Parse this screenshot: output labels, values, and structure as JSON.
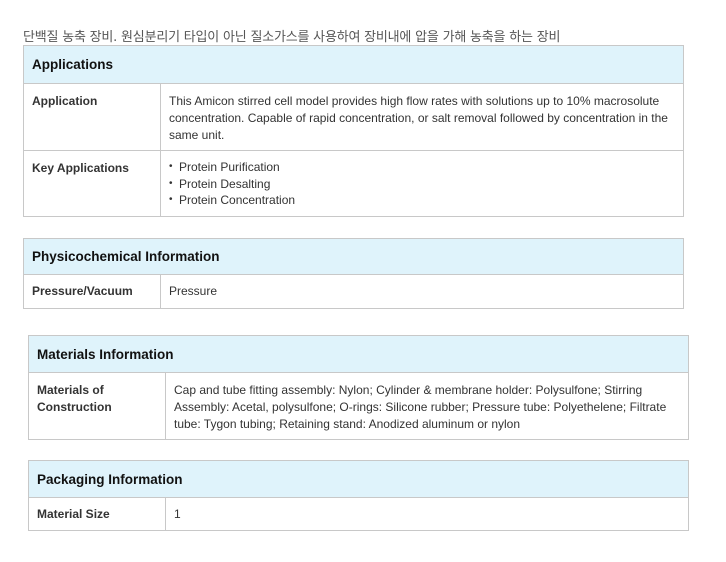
{
  "intro": "단백질 농축 장비. 원심분리기 타입이 아닌 질소가스를 사용하여 장비내에 압을 가해 농축을 하는 장비",
  "applications": {
    "title": "Applications",
    "application_label": "Application",
    "application_value": "This Amicon stirred cell model provides high flow rates with solutions up to 10% macrosolute concentration. Capable of rapid concentration, or salt removal followed by concentration in the same unit.",
    "key_label": "Key Applications",
    "key_items": [
      "Protein Purification",
      "Protein Desalting",
      "Protein Concentration"
    ]
  },
  "physicochemical": {
    "title": "Physicochemical Information",
    "pressure_label": "Pressure/Vacuum",
    "pressure_value": "Pressure"
  },
  "materials": {
    "title": "Materials Information",
    "construction_label": "Materials of Construction",
    "construction_value": "Cap and tube fitting assembly: Nylon; Cylinder & membrane holder: Polysulfone; Stirring Assembly: Acetal, polysulfone; O-rings: Silicone rubber; Pressure tube: Polyethelene; Filtrate tube: Tygon tubing; Retaining stand: Anodized aluminum or nylon"
  },
  "packaging": {
    "title": "Packaging Information",
    "size_label": "Material Size",
    "size_value": "1"
  },
  "colors": {
    "header_bg": "#dff3fb",
    "border": "#c8c8c8"
  }
}
